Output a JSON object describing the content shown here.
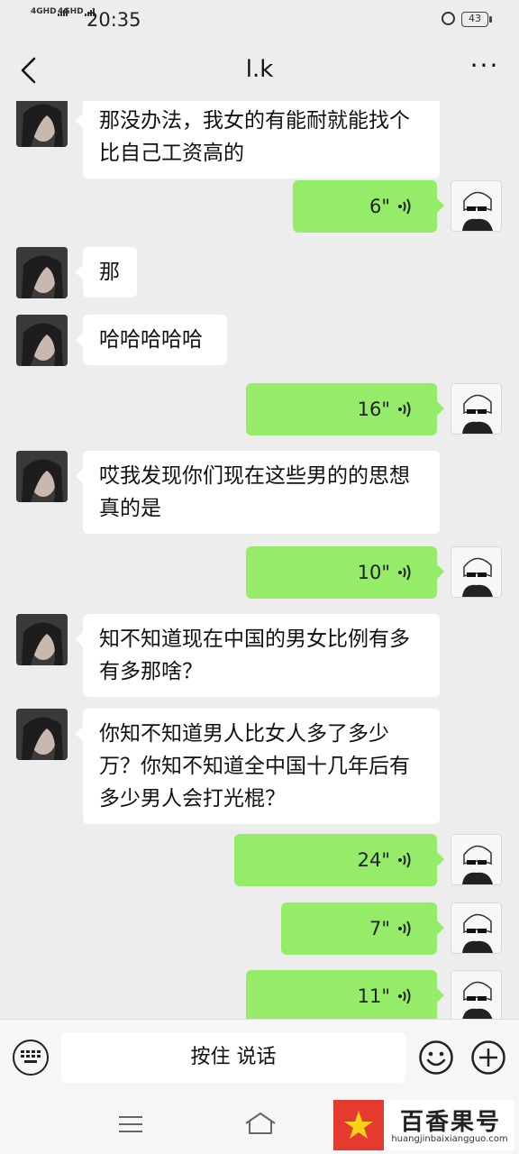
{
  "status_bar": {
    "signal_1": "4GHD",
    "signal_2": "4GHD",
    "time": "20:35",
    "battery": "43",
    "icons": [
      "alarm-icon",
      "battery-icon"
    ]
  },
  "header": {
    "title": "l.k",
    "more": "···",
    "icons": [
      "back-arrow-icon",
      "more-icon"
    ]
  },
  "messages": [
    {
      "side": "left",
      "text": "那没办法，我女的有能耐就能找个比自己工资高的"
    },
    {
      "side": "right",
      "type": "voice",
      "duration": "6\""
    },
    {
      "side": "left",
      "text": "那"
    },
    {
      "side": "left",
      "text": "哈哈哈哈哈"
    },
    {
      "side": "right",
      "type": "voice",
      "duration": "16\""
    },
    {
      "side": "left",
      "text": "哎我发现你们现在这些男的的思想真的是"
    },
    {
      "side": "right",
      "type": "voice",
      "duration": "10\""
    },
    {
      "side": "left",
      "text": "知不知道现在中国的男女比例有多有多那啥？"
    },
    {
      "side": "left",
      "text": "你知不知道男人比女人多了多少万？你知不知道全中国十几年后有多少男人会打光棍？"
    },
    {
      "side": "right",
      "type": "voice",
      "duration": "24\""
    },
    {
      "side": "right",
      "type": "voice",
      "duration": "7\""
    },
    {
      "side": "right",
      "type": "voice",
      "duration": "11\""
    }
  ],
  "input_bar": {
    "hold_to_talk": "按住 说话",
    "icons": [
      "keyboard-icon",
      "emoji-icon",
      "plus-icon"
    ]
  },
  "system_nav": {
    "icons": [
      "menu-icon",
      "home-icon"
    ]
  },
  "watermark": {
    "name": "百香果号",
    "url": "huangjinbaixiangguo.com"
  },
  "colors": {
    "background": "#ededed",
    "bubble_self": "#95ec69",
    "bubble_other": "#ffffff",
    "watermark_red": "#e53b2e"
  }
}
